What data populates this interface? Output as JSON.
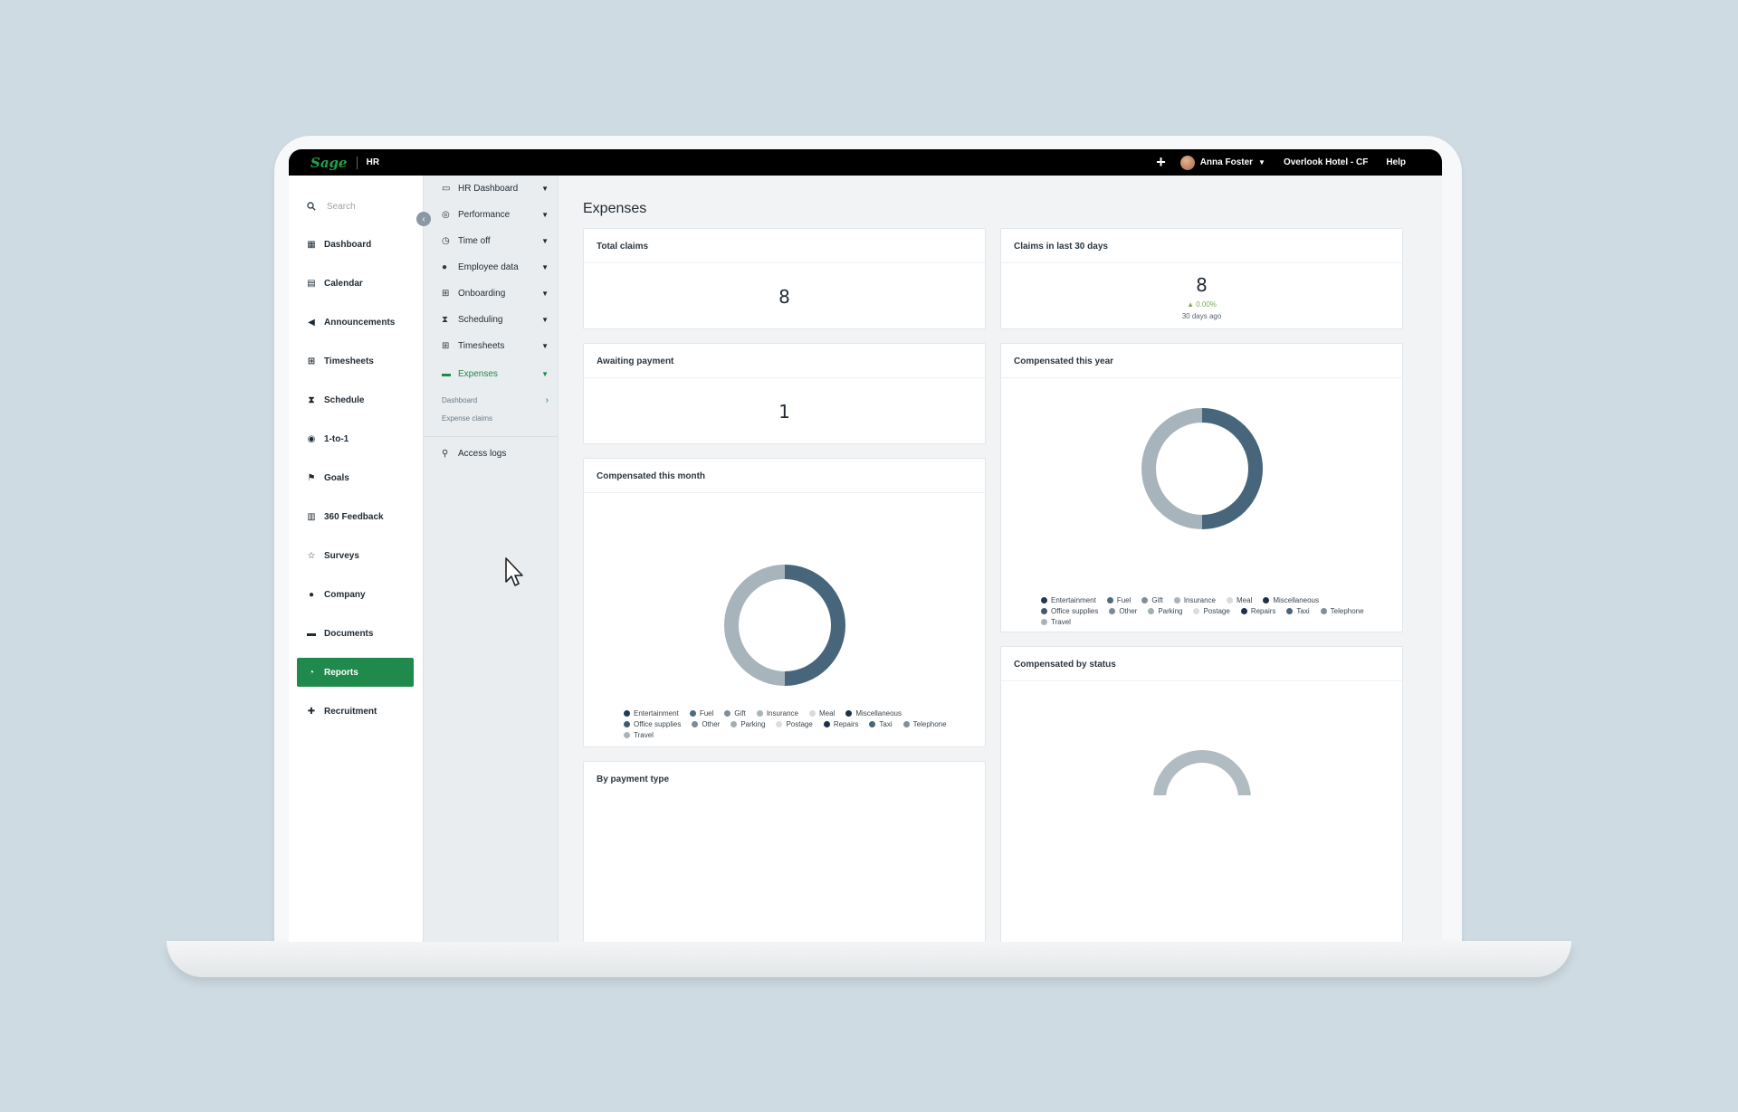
{
  "topbar": {
    "logo": "Sage",
    "app_name": "HR",
    "plus": "+",
    "user_name": "Anna Foster",
    "company": "Overlook Hotel - CF",
    "help": "Help"
  },
  "leftnav": {
    "search_placeholder": "Search",
    "items": [
      {
        "label": "Dashboard",
        "icon": "dashboard-icon",
        "glyph": "▦"
      },
      {
        "label": "Calendar",
        "icon": "calendar-icon",
        "glyph": "▤"
      },
      {
        "label": "Announcements",
        "icon": "megaphone-icon",
        "glyph": "◀"
      },
      {
        "label": "Timesheets",
        "icon": "table-icon",
        "glyph": "⊞"
      },
      {
        "label": "Schedule",
        "icon": "hourglass-icon",
        "glyph": "⧗"
      },
      {
        "label": "1-to-1",
        "icon": "chat-icon",
        "glyph": "◉"
      },
      {
        "label": "Goals",
        "icon": "flag-icon",
        "glyph": "⚑"
      },
      {
        "label": "360 Feedback",
        "icon": "document-icon",
        "glyph": "▥"
      },
      {
        "label": "Surveys",
        "icon": "star-icon",
        "glyph": "☆"
      },
      {
        "label": "Company",
        "icon": "people-icon",
        "glyph": "●"
      },
      {
        "label": "Documents",
        "icon": "folder-icon",
        "glyph": "▬"
      },
      {
        "label": "Reports",
        "icon": "pie-icon",
        "glyph": "◔",
        "active": true
      },
      {
        "label": "Recruitment",
        "icon": "add-user-icon",
        "glyph": "✚"
      }
    ]
  },
  "subnav": {
    "items": [
      {
        "label": "HR Dashboard",
        "icon": "monitor-icon",
        "glyph": "▭"
      },
      {
        "label": "Performance",
        "icon": "gauge-icon",
        "glyph": "◎"
      },
      {
        "label": "Time off",
        "icon": "clock-icon",
        "glyph": "◷"
      },
      {
        "label": "Employee data",
        "icon": "person-icon",
        "glyph": "●"
      },
      {
        "label": "Onboarding",
        "icon": "plus-square-icon",
        "glyph": "⊞"
      },
      {
        "label": "Scheduling",
        "icon": "hourglass-icon",
        "glyph": "⧗"
      },
      {
        "label": "Timesheets",
        "icon": "table-icon",
        "glyph": "⊞"
      },
      {
        "label": "Expenses",
        "icon": "wallet-icon",
        "glyph": "▬",
        "active": true
      }
    ],
    "expenses_children": [
      "Dashboard",
      "Expense claims"
    ],
    "access_logs": "Access logs"
  },
  "main": {
    "title": "Expenses",
    "total_claims": {
      "title": "Total claims",
      "value": "8"
    },
    "claims_30": {
      "title": "Claims in last 30 days",
      "value": "8",
      "delta": "▲ 0.00%",
      "ago": "30 days ago"
    },
    "awaiting": {
      "title": "Awaiting payment",
      "value": "1"
    },
    "comp_month": {
      "title": "Compensated this month"
    },
    "comp_year": {
      "title": "Compensated this year"
    },
    "by_payment": {
      "title": "By payment type"
    },
    "by_status": {
      "title": "Compensated by status"
    }
  },
  "legend": [
    {
      "label": "Entertainment",
      "color": "#1f3a52"
    },
    {
      "label": "Fuel",
      "color": "#4f6b7e"
    },
    {
      "label": "Gift",
      "color": "#7d8f9a"
    },
    {
      "label": "Insurance",
      "color": "#a8b3ba"
    },
    {
      "label": "Meal",
      "color": "#d6dbde"
    },
    {
      "label": "Miscellaneous",
      "color": "#1c3148"
    },
    {
      "label": "Office supplies",
      "color": "#3f5a6e"
    },
    {
      "label": "Other",
      "color": "#7b8c97"
    },
    {
      "label": "Parking",
      "color": "#a2adb4"
    },
    {
      "label": "Postage",
      "color": "#d9dee1"
    },
    {
      "label": "Repairs",
      "color": "#1d3246"
    },
    {
      "label": "Taxi",
      "color": "#48657a"
    },
    {
      "label": "Telephone",
      "color": "#7f909b"
    },
    {
      "label": "Travel",
      "color": "#a9b3b9"
    }
  ],
  "chart_data": [
    {
      "type": "pie",
      "title": "Compensated this month",
      "slices": [
        {
          "label": "Taxi",
          "value": 50
        },
        {
          "label": "Travel",
          "value": 50
        }
      ]
    },
    {
      "type": "pie",
      "title": "Compensated this year",
      "slices": [
        {
          "label": "Taxi",
          "value": 50
        },
        {
          "label": "Travel",
          "value": 50
        }
      ]
    }
  ],
  "colors": {
    "accent": "#1f8a4c",
    "donut_dark": "#47667b",
    "donut_light": "#a8b4bb"
  }
}
